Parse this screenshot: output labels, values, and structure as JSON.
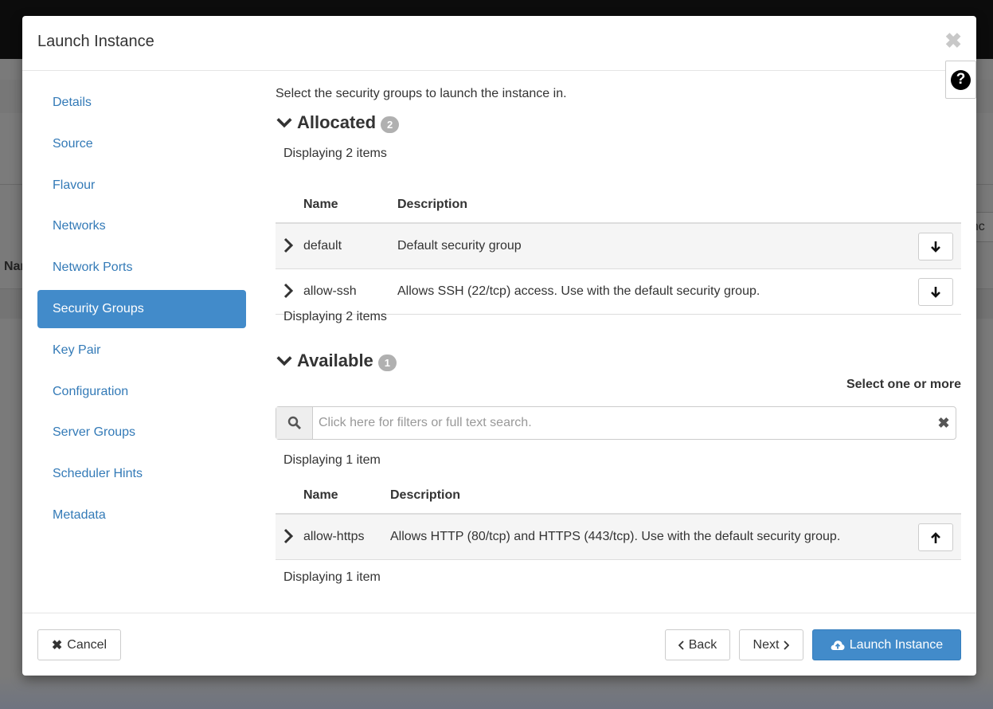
{
  "background": {
    "partial_label": "Nar",
    "partial_button": "anc"
  },
  "modal": {
    "title": "Launch Instance",
    "close_icon": "close-icon",
    "help_icon": "question-circle-icon"
  },
  "nav": {
    "items": [
      {
        "label": "Details"
      },
      {
        "label": "Source"
      },
      {
        "label": "Flavour"
      },
      {
        "label": "Networks"
      },
      {
        "label": "Network Ports"
      },
      {
        "label": "Security Groups",
        "active": true
      },
      {
        "label": "Key Pair"
      },
      {
        "label": "Configuration"
      },
      {
        "label": "Server Groups"
      },
      {
        "label": "Scheduler Hints"
      },
      {
        "label": "Metadata"
      }
    ]
  },
  "content": {
    "intro": "Select the security groups to launch the instance in.",
    "allocated": {
      "title": "Allocated",
      "count": "2",
      "display_top": "Displaying 2 items",
      "display_bottom": "Displaying 2 items",
      "columns": {
        "name": "Name",
        "description": "Description"
      },
      "rows": [
        {
          "name": "default",
          "description": "Default security group",
          "action_icon": "arrow-down-icon"
        },
        {
          "name": "allow-ssh",
          "description": "Allows SSH (22/tcp) access. Use with the default security group.",
          "action_icon": "arrow-down-icon"
        }
      ]
    },
    "available": {
      "title": "Available",
      "count": "1",
      "select_hint": "Select one or more",
      "search_placeholder": "Click here for filters or full text search.",
      "display_top": "Displaying 1 item",
      "display_bottom": "Displaying 1 item",
      "columns": {
        "name": "Name",
        "description": "Description"
      },
      "rows": [
        {
          "name": "allow-https",
          "description": "Allows HTTP (80/tcp) and HTTPS (443/tcp). Use with the default security group.",
          "action_icon": "arrow-up-icon"
        }
      ]
    }
  },
  "footer": {
    "cancel_label": "Cancel",
    "back_label": "Back",
    "next_label": "Next",
    "launch_label": "Launch Instance"
  },
  "colors": {
    "primary": "#428bca",
    "link": "#337ab7",
    "badge": "#b0b0b0"
  }
}
